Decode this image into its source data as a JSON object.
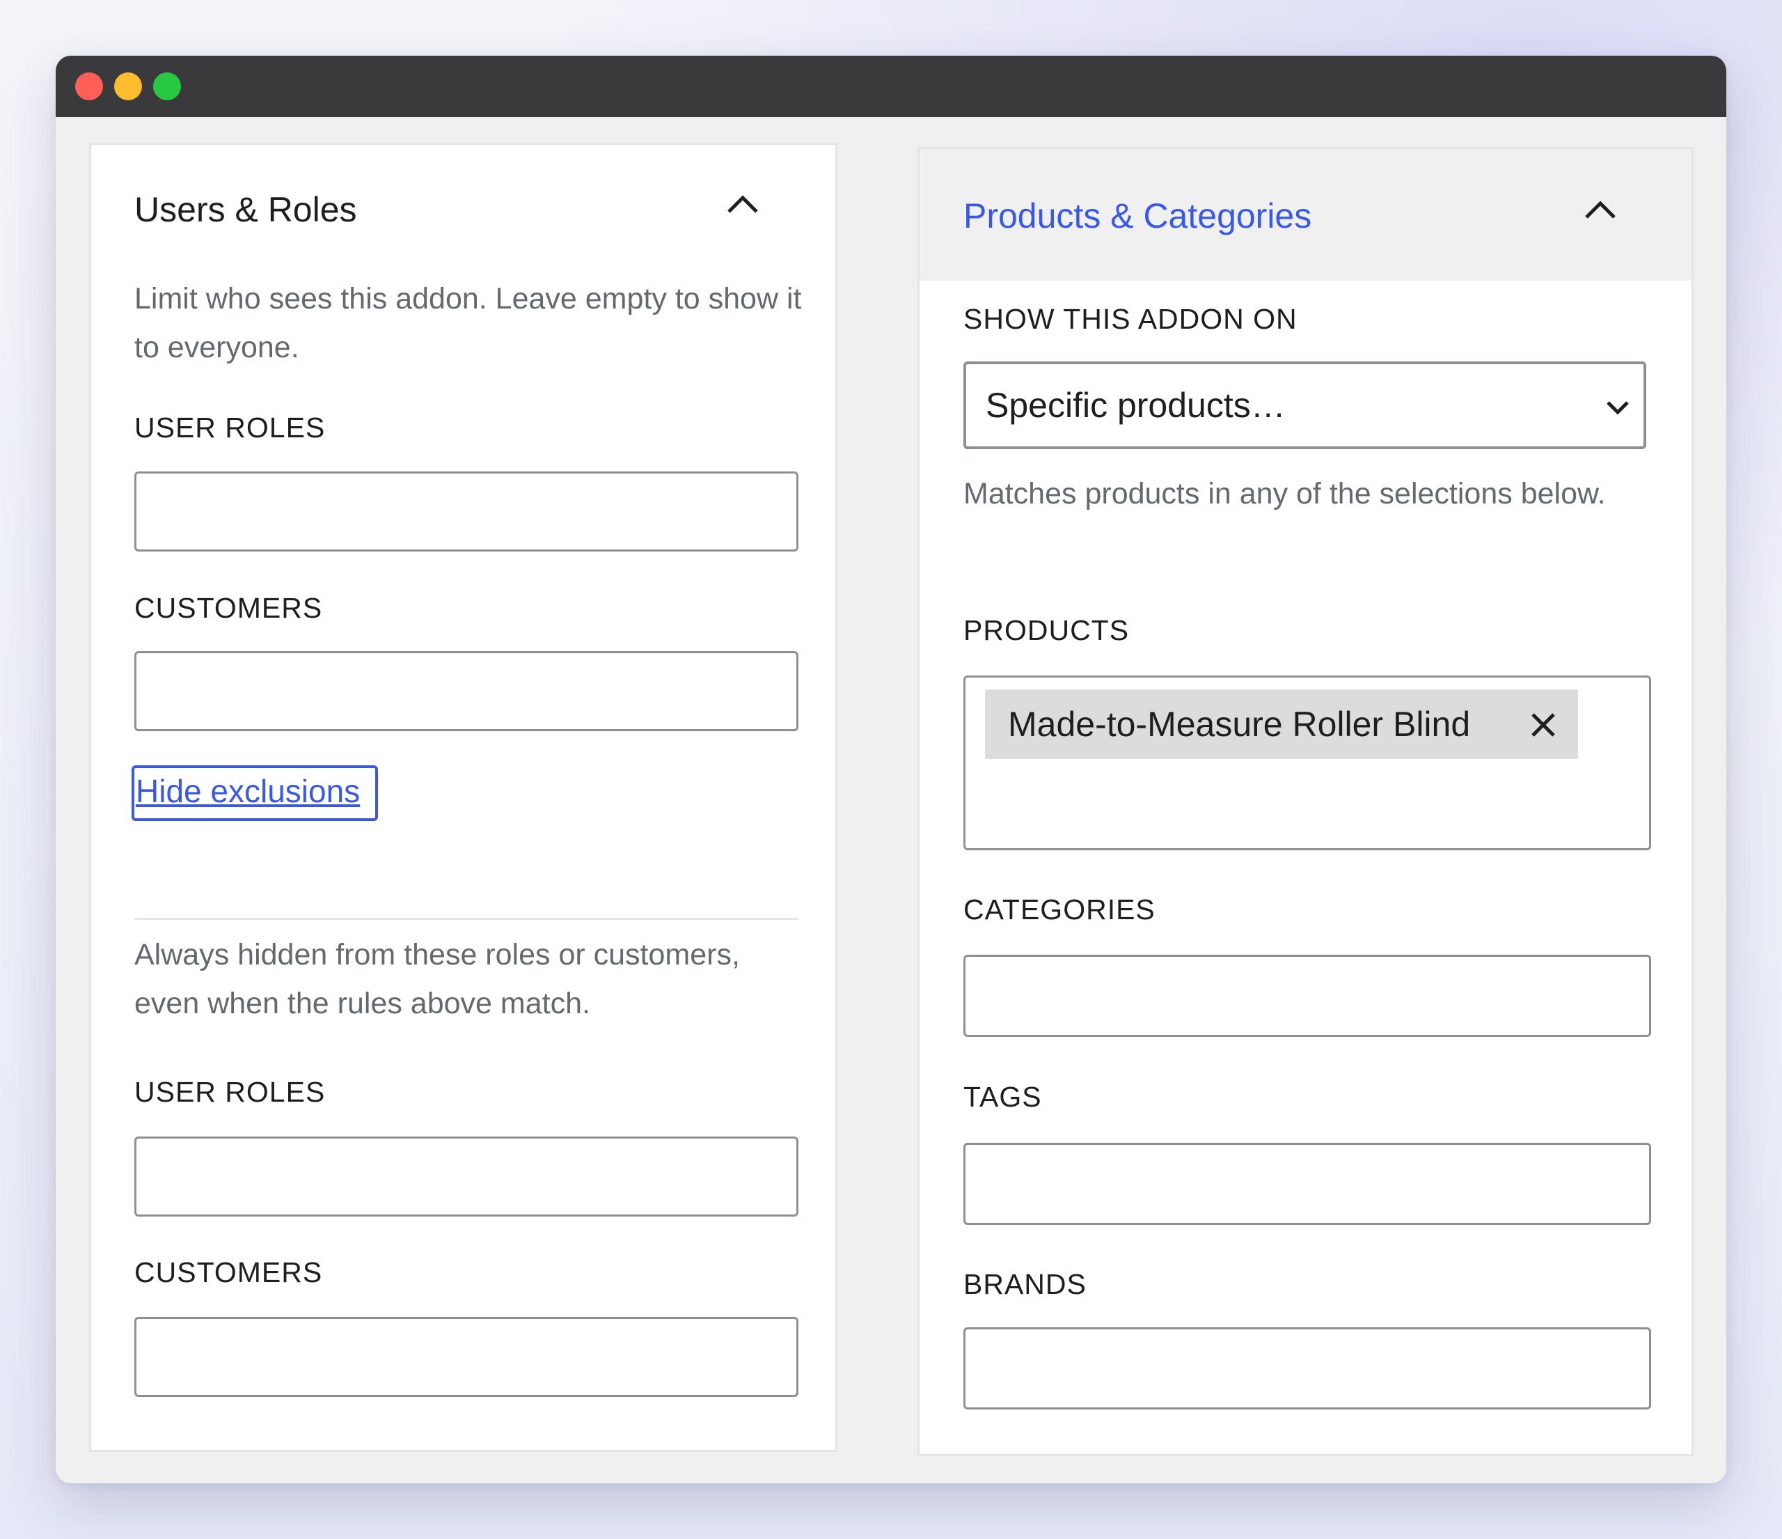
{
  "window": {
    "traffic_lights": [
      "close",
      "minimize",
      "zoom"
    ]
  },
  "users_roles": {
    "title": "Users & Roles",
    "description": "Limit who sees this addon. Leave empty to show it to everyone.",
    "user_roles_label": "USER ROLES",
    "user_roles_value": "",
    "customers_label": "CUSTOMERS",
    "customers_value": "",
    "toggle_link": "Hide exclusions",
    "exclusions_description": "Always hidden from these roles or customers, even when the rules above match.",
    "exclude_user_roles_label": "USER ROLES",
    "exclude_user_roles_value": "",
    "exclude_customers_label": "CUSTOMERS",
    "exclude_customers_value": ""
  },
  "products_categories": {
    "title": "Products & Categories",
    "show_on_label": "SHOW THIS ADDON ON",
    "show_on_value": "Specific products…",
    "description": "Matches products in any of the selections below.",
    "products_label": "PRODUCTS",
    "products_selected": [
      "Made-to-Measure Roller Blind"
    ],
    "categories_label": "CATEGORIES",
    "tags_label": "TAGS",
    "brands_label": "BRANDS"
  },
  "colors": {
    "accent": "#3858e9",
    "titlebar": "#3a3a3c",
    "panel_header": "#f0f0f0",
    "input_border": "#8c8f94",
    "chip_bg": "#dcdcde"
  },
  "icons": [
    "chevron-up-icon",
    "chevron-down-icon",
    "close-icon"
  ]
}
